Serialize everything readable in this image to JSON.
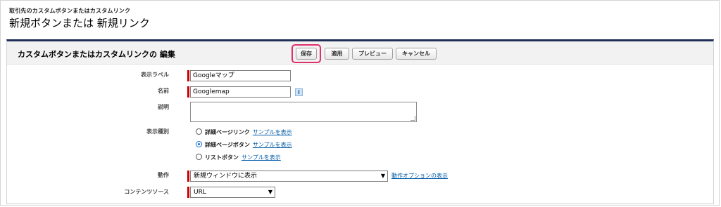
{
  "page": {
    "subtitle": "取引先のカスタムボタンまたはカスタムリンク",
    "title": "新規ボタンまたは 新規リンク"
  },
  "panel": {
    "title": "カスタムボタンまたはカスタムリンクの 編集",
    "buttons": {
      "save": "保存",
      "apply": "適用",
      "preview": "プレビュー",
      "cancel": "キャンセル"
    }
  },
  "form": {
    "display_label": {
      "label": "表示ラベル",
      "value": "Googleマップ"
    },
    "name": {
      "label": "名前",
      "value": "Googlemap",
      "info_icon": "i"
    },
    "description": {
      "label": "説明",
      "value": ""
    },
    "display_type": {
      "label": "表示種別",
      "options": [
        {
          "label": "詳細ページリンク",
          "link": "サンプルを表示",
          "selected": false
        },
        {
          "label": "詳細ページボタン",
          "link": "サンプルを表示",
          "selected": true
        },
        {
          "label": "リストボタン",
          "link": "サンプルを表示",
          "selected": false
        }
      ]
    },
    "behavior": {
      "label": "動作",
      "value": "新規ウィンドウに表示",
      "options_link": "動作オプションの表示"
    },
    "content_source": {
      "label": "コンテンツソース",
      "value": "URL"
    }
  },
  "colors": {
    "highlight": "#e0306c",
    "required": "#cc0000",
    "panel_border_top": "#1f2f59",
    "link": "#015ba7"
  }
}
